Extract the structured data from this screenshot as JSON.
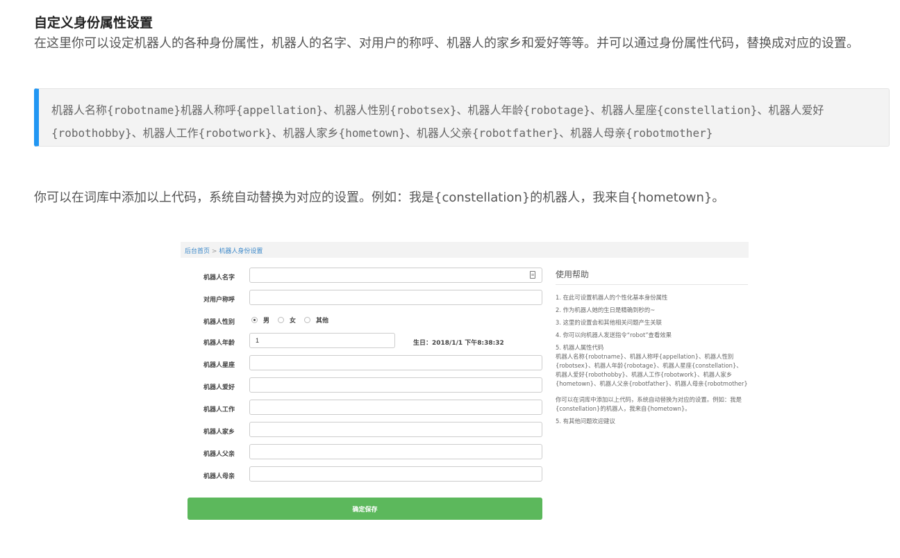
{
  "doc": {
    "title": "自定义身份属性设置",
    "intro": "在这里你可以设定机器人的各种身份属性，机器人的名字、对用户的称呼、机器人的家乡和爱好等等。并可以通过身份属性代码，替换成对应的设置。",
    "code_line1": "机器人名称{robotname}机器人称呼{appellation}、机器人性别{robotsex}、机器人年龄{robotage}、机器人星座{constellation}、机器人爱好",
    "code_line2": "{robothobby}、机器人工作{robotwork}、机器人家乡{hometown}、机器人父亲{robotfather}、机器人母亲{robotmother}",
    "example": "你可以在词库中添加以上代码，系统自动替换为对应的设置。例如：我是{constellation}的机器人，我来自{hometown}。"
  },
  "screenshot": {
    "breadcrumb": {
      "home": "后台首页",
      "separator": ">",
      "current": "机器人身份设置"
    },
    "form": {
      "name_label": "机器人名字",
      "name_value": "",
      "appellation_label": "对用户称呼",
      "appellation_value": "",
      "sex_label": "机器人性别",
      "sex_options": [
        "男",
        "女",
        "其他"
      ],
      "sex_selected": "男",
      "age_label": "机器人年龄",
      "age_value": "1",
      "birthday": "生日：2018/1/1 下午8:38:32",
      "constellation_label": "机器人星座",
      "hobby_label": "机器人爱好",
      "work_label": "机器人工作",
      "hometown_label": "机器人家乡",
      "father_label": "机器人父亲",
      "mother_label": "机器人母亲",
      "save_label": "确定保存"
    },
    "help": {
      "title": "使用帮助",
      "items": [
        "1. 在此可设置机器人的个性化基本身份属性",
        "2. 作为机器人她的生日是精确到秒的~",
        "3. 这里的设置会和其他相关问题产生关联",
        "4. 你可以向机器人发送指令“robot”查看效果",
        "5. 机器人属性代码\n机器人名称{robotname}、机器人称呼{appellation}、机器人性别{robotsex}、机器人年龄{robotage}、机器人星座{constellation}、机器人爱好{robothobby}、机器人工作{robotwork}、机器人家乡{hometown}、机器人父亲{robotfather}、机器人母亲{robotmother}",
        "你可以在词库中添加以上代码，系统自动替换为对应的设置。例如：我是{constellation}的机器人，我来自{hometown}。",
        "5. 有其他问题欢迎建议"
      ]
    }
  }
}
